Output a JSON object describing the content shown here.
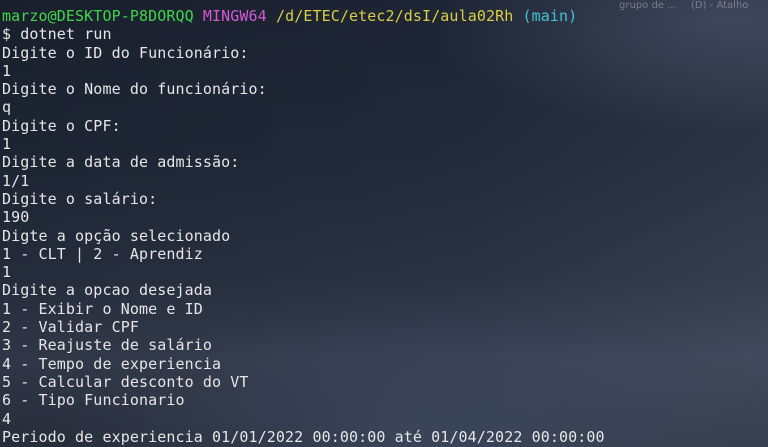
{
  "desktop": {
    "shortcuts": [
      "grupo de ...",
      "(D) - Atalho"
    ]
  },
  "prompt": {
    "user_host": "marzo@DESKTOP-P8DORQQ",
    "shell": "MINGW64",
    "path": "/d/ETEC/etec2/dsI/aula02Rh",
    "branch": "(main)",
    "symbol": "$",
    "command": "dotnet run"
  },
  "output_lines": [
    "Digite o ID do Funcionário:",
    "1",
    "Digite o Nome do funcionário:",
    "q",
    "Digite o CPF:",
    "1",
    "Digite a data de admissão:",
    "1/1",
    "Digite o salário:",
    "190",
    "Digte a opção selecionado",
    "1 - CLT | 2 - Aprendiz",
    "1",
    "Digite a opcao desejada",
    "1 - Exibir o Nome e ID",
    "2 - Validar CPF",
    "3 - Reajuste de salário",
    "4 - Tempo de experiencia",
    "5 - Calcular desconto do VT",
    "6 - Tipo Funcionario",
    "4",
    "Periodo de experiencia 01/01/2022 00:00:00 até 01/04/2022 00:00:00"
  ]
}
